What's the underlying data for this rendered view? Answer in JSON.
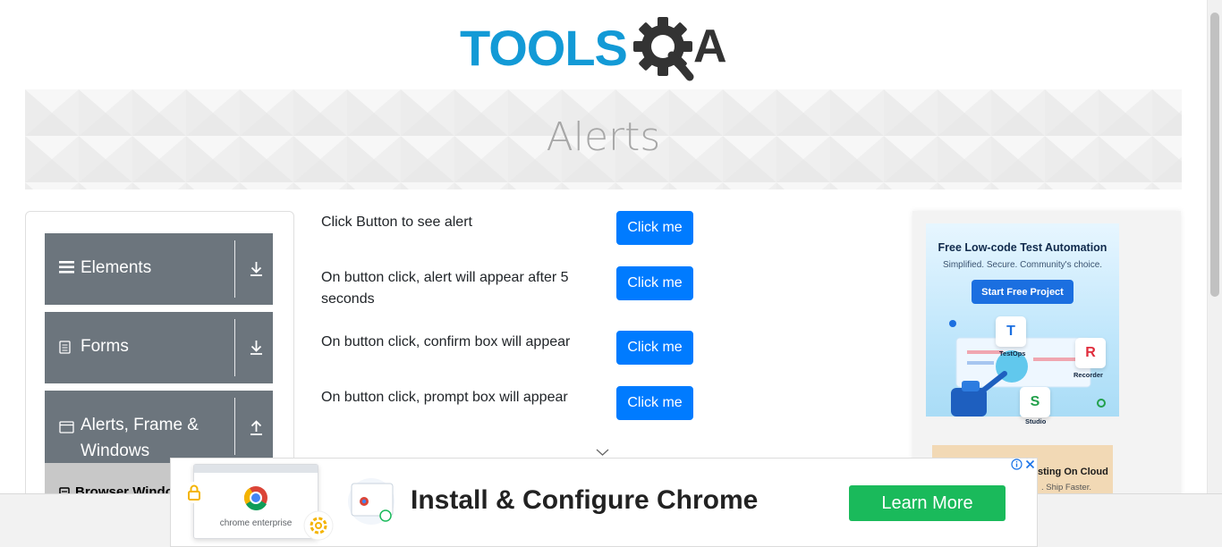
{
  "logo": {
    "text_tools": "TOOLS",
    "text_qa_letter": "A",
    "colors": {
      "tools": "#139ad6",
      "gear": "#333333"
    }
  },
  "banner": {
    "title": "Alerts"
  },
  "sidebar": {
    "groups": [
      {
        "label": "Elements",
        "icon": "hamburger-icon",
        "arrow": "download-arrow-icon"
      },
      {
        "label": "Forms",
        "icon": "document-icon",
        "arrow": "download-arrow-icon"
      },
      {
        "label": "Alerts, Frame & Windows",
        "icon": "window-icon",
        "arrow": "upload-arrow-icon"
      }
    ],
    "active_item": {
      "label": "Browser Windows",
      "icon": "document-icon"
    }
  },
  "alerts": {
    "rows": [
      {
        "text": "Click Button to see alert",
        "button": "Click me"
      },
      {
        "text": "On button click, alert will appear after 5 seconds",
        "button": "Click me"
      },
      {
        "text": "On button click, confirm box will appear",
        "button": "Click me"
      },
      {
        "text": "On button click, prompt box will appear",
        "button": "Click me"
      }
    ]
  },
  "right_ad": {
    "title": "Free Low-code Test Automation",
    "subtitle": "Simplified. Secure. Community's choice.",
    "button": "Start Free Project",
    "tiles": [
      {
        "letter": "T",
        "label": "TestOps",
        "color": "#1b6fe0"
      },
      {
        "letter": "R",
        "label": "Recorder",
        "color": "#e02d3c"
      },
      {
        "letter": "S",
        "label": "Studio",
        "color": "#22a04b"
      }
    ],
    "second_title": "sting On Cloud",
    "second_sub": ". Ship Faster."
  },
  "bottom_ad": {
    "caption": "chrome enterprise",
    "headline": "Install & Configure Chrome",
    "button": "Learn More"
  },
  "colors": {
    "primary_button": "#007bff",
    "group_bg": "#6c757d",
    "learn_more": "#1aba5b"
  }
}
